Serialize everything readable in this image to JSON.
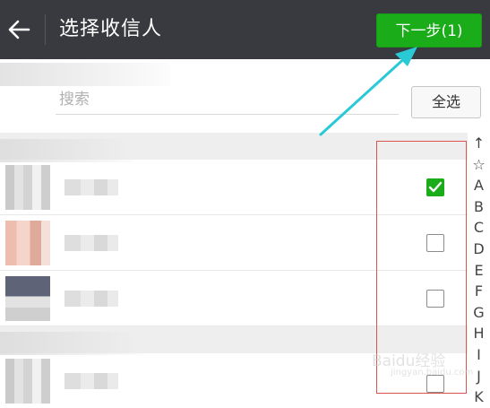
{
  "header": {
    "title": "选择收信人",
    "next_label": "下一步(1)"
  },
  "search": {
    "placeholder": "搜索",
    "select_all_label": "全选"
  },
  "contacts": [
    {
      "checked": true
    },
    {
      "checked": false
    },
    {
      "checked": false
    },
    {
      "checked": false
    }
  ],
  "index": {
    "letters": [
      "↑",
      "☆",
      "A",
      "B",
      "C",
      "D",
      "E",
      "F",
      "G",
      "H",
      "I",
      "J",
      "K"
    ]
  },
  "watermark": {
    "text": "Baidu经验",
    "sub": "jingyan.baidu.com"
  },
  "colors": {
    "topbar": "#393a3f",
    "accent_green": "#1aad19",
    "annotation_cyan": "#29c9d6",
    "annotation_red": "#d9534f"
  }
}
